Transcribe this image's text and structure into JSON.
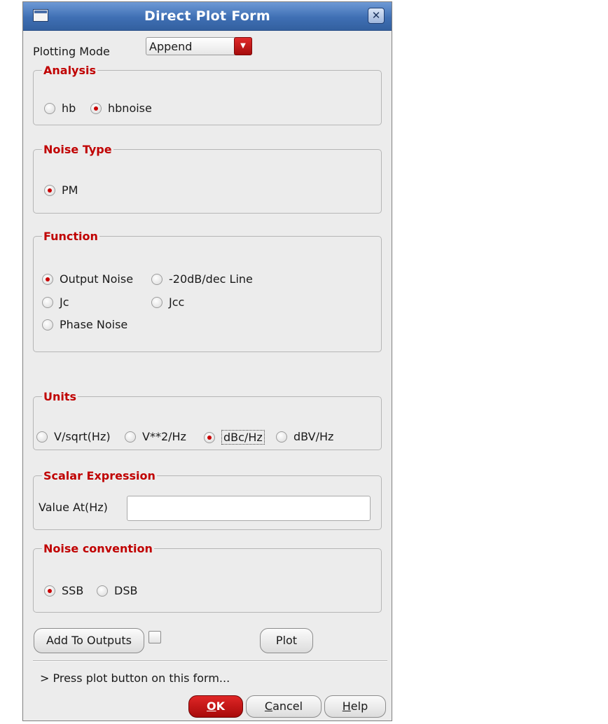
{
  "window": {
    "title": "Direct Plot Form",
    "icon": "window-menu-icon",
    "close_icon": "close-icon",
    "close_glyph": "✕"
  },
  "plotting_mode": {
    "label": "Plotting Mode",
    "value": "Append",
    "arrow": "▼"
  },
  "analysis": {
    "legend": "Analysis",
    "options": [
      {
        "label": "hb",
        "checked": false
      },
      {
        "label": "hbnoise",
        "checked": true
      }
    ]
  },
  "noise_type": {
    "legend": "Noise Type",
    "options": [
      {
        "label": "PM",
        "checked": true
      }
    ]
  },
  "function": {
    "legend": "Function",
    "options": [
      {
        "label": "Output Noise",
        "checked": true
      },
      {
        "label": "-20dB/dec Line",
        "checked": false
      },
      {
        "label": "Jc",
        "checked": false
      },
      {
        "label": "Jcc",
        "checked": false
      },
      {
        "label": "Phase Noise",
        "checked": false
      }
    ]
  },
  "units": {
    "legend": "Units",
    "options": [
      {
        "label": "V/sqrt(Hz)",
        "checked": false
      },
      {
        "label": "V**2/Hz",
        "checked": false
      },
      {
        "label": "dBc/Hz",
        "checked": true
      },
      {
        "label": "dBV/Hz",
        "checked": false
      }
    ]
  },
  "scalar_expression": {
    "legend": "Scalar Expression",
    "value_label": "Value At(Hz)",
    "value": ""
  },
  "noise_convention": {
    "legend": "Noise convention",
    "options": [
      {
        "label": "SSB",
        "checked": true
      },
      {
        "label": "DSB",
        "checked": false
      }
    ]
  },
  "actions": {
    "add_to_outputs": "Add To Outputs",
    "add_to_outputs_checked": false,
    "plot": "Plot"
  },
  "status": "> Press plot button on this form...",
  "footer": {
    "ok_mnemonic": "O",
    "ok_rest": "K",
    "cancel_mnemonic": "C",
    "cancel_rest": "ancel",
    "help_mnemonic": "H",
    "help_rest": "elp"
  },
  "colors": {
    "title_bar": "#3f6fb4",
    "legend_text": "#c00000",
    "radio_checked": "#c80000",
    "ok_button": "#c01010"
  }
}
